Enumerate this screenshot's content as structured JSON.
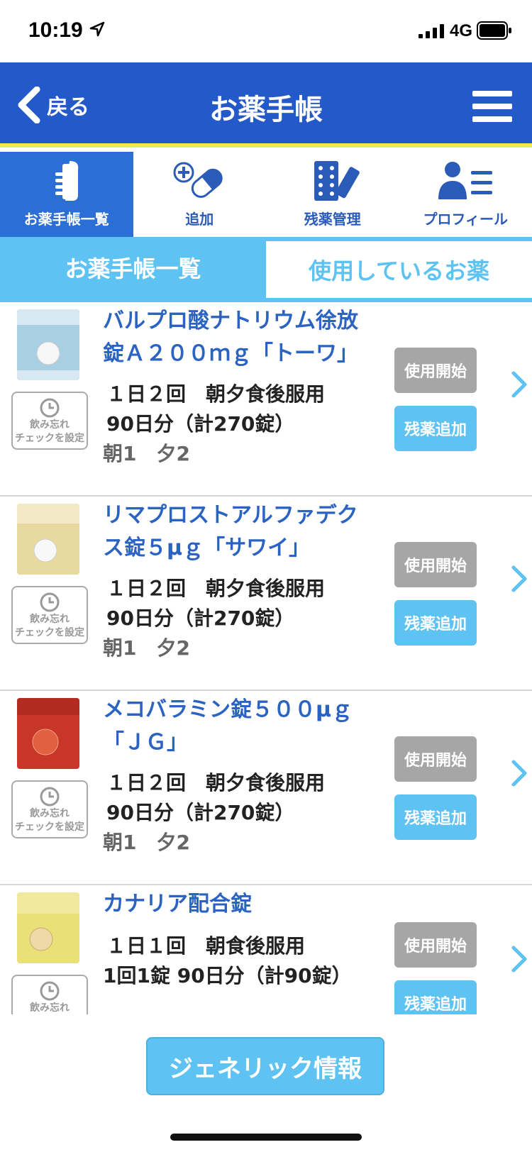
{
  "status": {
    "time": "10:19",
    "network": "4G"
  },
  "nav": {
    "back_label": "戻る",
    "title": "お薬手帳"
  },
  "icon_tabs": [
    {
      "label": "お薬手帳一覧",
      "icon": "notebook-hand-icon",
      "active": true
    },
    {
      "label": "追加",
      "icon": "add-capsule-icon",
      "active": false
    },
    {
      "label": "残薬管理",
      "icon": "pill-pack-icon",
      "active": false
    },
    {
      "label": "プロフィール",
      "icon": "profile-icon",
      "active": false
    }
  ],
  "segment": {
    "left": "お薬手帳一覧",
    "right": "使用しているお薬"
  },
  "medications": [
    {
      "name": "バルプロ酸ナトリウム徐放錠Ａ２００ｍｇ「トーワ」",
      "dosage": "１日２回　朝夕食後服用",
      "amount": "90日分（計270錠）",
      "schedule": "朝1　夕2",
      "thumb_color": "#a9cfe2"
    },
    {
      "name": "リマプロストアルファデクス錠５μｇ「サワイ」",
      "dosage": "１日２回　朝夕食後服用",
      "amount": "90日分（計270錠）",
      "schedule": "朝1　夕2",
      "thumb_color": "#e8d9a0"
    },
    {
      "name": "メコバラミン錠５００μｇ「ＪＧ」",
      "dosage": "１日２回　朝夕食後服用",
      "amount": "90日分（計270錠）",
      "schedule": "朝1　夕2",
      "thumb_color": "#c8362a"
    },
    {
      "name": "カナリア配合錠",
      "dosage": "１日１回　朝食後服用",
      "amount": "1回1錠 90日分（計90錠）",
      "schedule": "",
      "thumb_color": "#e9e07a"
    }
  ],
  "remind_label_1": "飲み忘れ",
  "remind_label_2": "チェックを設定",
  "start_label": "使用開始",
  "add_label": "残薬追加",
  "generic_button": "ジェネリック情報"
}
